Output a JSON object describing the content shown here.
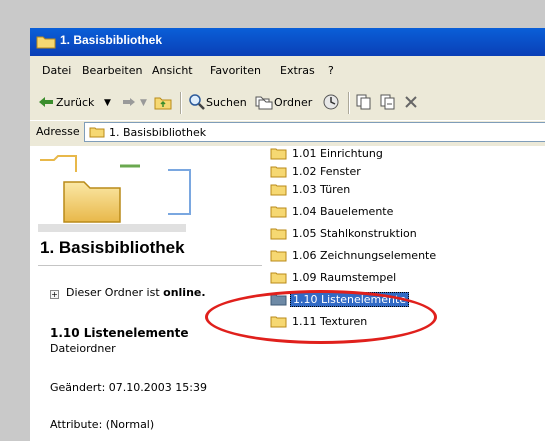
{
  "window": {
    "title": "1. Basisbibliothek",
    "title_bar_color": "#0a4fc8"
  },
  "menu": {
    "items": [
      "Datei",
      "Bearbeiten",
      "Ansicht",
      "Favoriten",
      "Extras",
      "?"
    ]
  },
  "toolbar": {
    "back_label": "Zurück",
    "search_label": "Suchen",
    "folders_label": "Ordner",
    "icons": [
      "back-arrow-icon",
      "forward-arrow-icon",
      "folder-up-icon",
      "search-icon",
      "folders-icon",
      "history-icon",
      "copy-to-icon",
      "move-to-icon",
      "delete-icon"
    ]
  },
  "address": {
    "label": "Adresse",
    "value": "1. Basisbibliothek"
  },
  "left_pane": {
    "title": "1. Basisbibliothek",
    "online_prefix": "Dieser Ordner ist ",
    "online_bold": "online.",
    "selected_name_bold": "1.10",
    "selected_name_rest": " Listenelemente",
    "selected_type": "Dateiordner",
    "changed": "Geändert: 07.10.2003 15:39",
    "attributes": "Attribute: (Normal)"
  },
  "files": [
    {
      "label": "1.01 Einrichtung",
      "selected": false
    },
    {
      "label": "1.02 Fenster",
      "selected": false
    },
    {
      "label": "1.03 Türen",
      "selected": false
    },
    {
      "label": "1.04 Bauelemente",
      "selected": false
    },
    {
      "label": "1.05 Stahlkonstruktion",
      "selected": false
    },
    {
      "label": "1.06 Zeichnungselemente",
      "selected": false
    },
    {
      "label": "1.09 Raumstempel",
      "selected": false
    },
    {
      "label": "1.10 Listenelemente",
      "selected": true
    },
    {
      "label": "1.11 Texturen",
      "selected": false
    }
  ],
  "colors": {
    "selection": "#316ac5",
    "highlight_ellipse": "#e0201c",
    "folder_yellow": "#f6d872"
  }
}
